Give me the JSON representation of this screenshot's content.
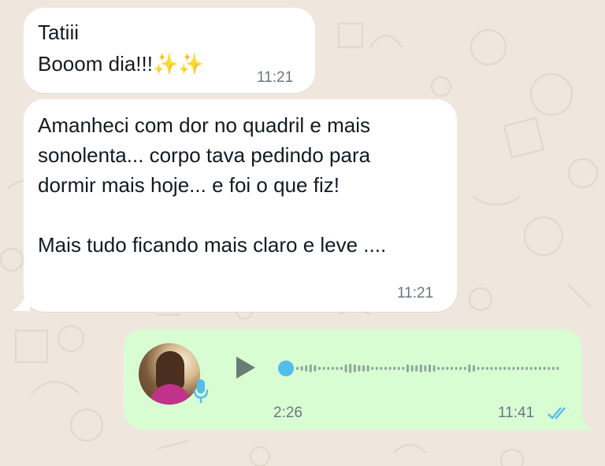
{
  "messages": [
    {
      "direction": "incoming",
      "line1": "Tatiii",
      "line2": "Booom dia!!!✨✨",
      "time": "11:21"
    },
    {
      "direction": "incoming",
      "text": "Amanheci com dor no quadril e mais\nsonolenta... corpo tava pedindo para\ndormir mais hoje... e foi o que fiz!\n\nMais tudo ficando mais claro e leve ....",
      "time": "11:21"
    }
  ],
  "voice_note": {
    "direction": "outgoing",
    "duration": "2:26",
    "time": "11:41",
    "status_icon": "double-check-read-icon",
    "play_icon": "play-icon",
    "mic_icon": "microphone-icon",
    "playback_progress": 0.0
  },
  "colors": {
    "chat_background": "#efe7dd",
    "incoming_bubble": "#ffffff",
    "outgoing_bubble": "#d9fdd3",
    "accent_blue": "#53bdeb",
    "text": "#111b21",
    "meta_text": "#667781"
  }
}
